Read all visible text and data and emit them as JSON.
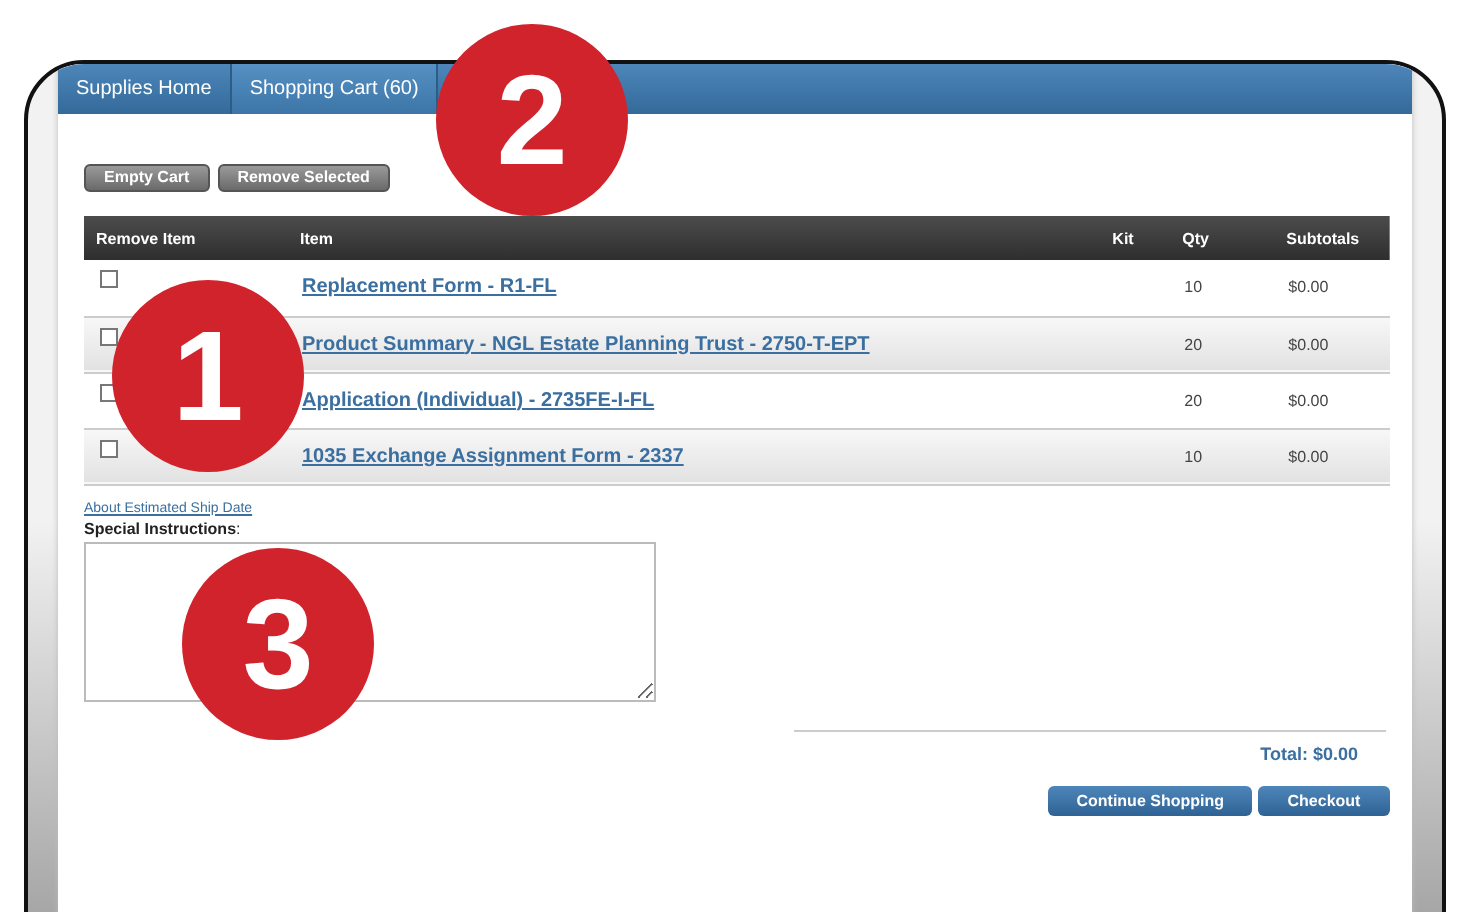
{
  "nav": [
    {
      "label": "Supplies Home",
      "selected": false
    },
    {
      "label": "Shopping Cart (60)",
      "selected": true
    }
  ],
  "actions": [
    "Empty Cart",
    "Remove Selected"
  ],
  "table": {
    "columns": [
      "Remove Item",
      "Item",
      "Kit",
      "Qty",
      "Subtotals"
    ],
    "rows": [
      {
        "checked": false,
        "item": "Replacement Form - R1-FL",
        "qty": "10",
        "subtotal": "$0.00"
      },
      {
        "checked": false,
        "item": "Product Summary - NGL Estate Planning Trust - 2750-T-EPT",
        "qty": "20",
        "subtotal": "$0.00"
      },
      {
        "checked": false,
        "item": "Application (Individual) - 2735FE-I-FL",
        "qty": "20",
        "subtotal": "$0.00"
      },
      {
        "checked": false,
        "item": "1035 Exchange Assignment Form - 2337",
        "qty": "10",
        "subtotal": "$0.00"
      }
    ]
  },
  "ship_date_link": "About Estimated Ship Date",
  "instructions_label": "Special Instructions",
  "instructions_colon": ":",
  "total": "Total: $0.00",
  "buttons": [
    "Continue Shopping",
    "Checkout"
  ],
  "callouts": [
    "1",
    "2",
    "3"
  ]
}
